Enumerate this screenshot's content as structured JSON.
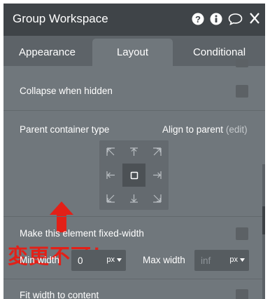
{
  "header": {
    "title": "Group Workspace",
    "icons": [
      "help-icon",
      "info-icon",
      "comment-icon",
      "close-icon"
    ]
  },
  "tabs": [
    {
      "label": "Appearance",
      "active": false
    },
    {
      "label": "Layout",
      "active": true
    },
    {
      "label": "Conditional",
      "active": false
    }
  ],
  "layout": {
    "collapse_when_hidden": {
      "label": "Collapse when hidden",
      "checked": false
    },
    "parent_container_type": {
      "label": "Parent container type"
    },
    "align_to_parent": {
      "label": "Align to parent",
      "edit_link": "(edit)",
      "selected": "center"
    },
    "fixed_width": {
      "label": "Make this element fixed-width",
      "checked": false
    },
    "min_width": {
      "label": "Min width",
      "value": "0",
      "unit": "px"
    },
    "max_width": {
      "label": "Max width",
      "placeholder": "inf",
      "unit": "px"
    },
    "fit_width": {
      "label": "Fit width to content",
      "checked": false
    }
  },
  "annotation": {
    "text": "変更不可！",
    "color": "#e32018"
  },
  "colors": {
    "panel_bg": "#70777c",
    "titlebar_bg": "#3f4448",
    "tabs_bg": "#5d6368",
    "checkbox_bg": "#5c6165",
    "annotation_red": "#e32018"
  }
}
